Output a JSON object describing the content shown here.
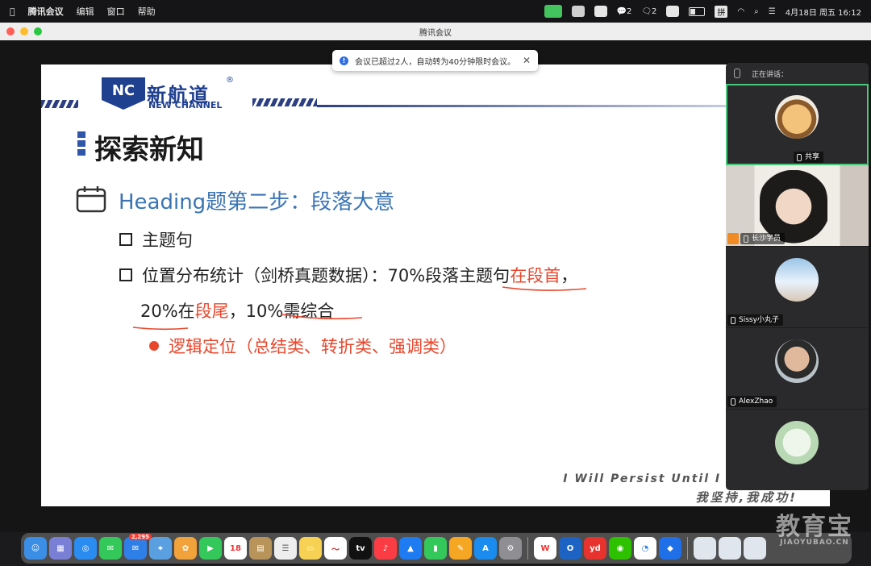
{
  "menubar": {
    "app_name": "腾讯会议",
    "menus": [
      "编辑",
      "窗口",
      "帮助"
    ],
    "chat_count_a": "2",
    "chat_count_b": "2",
    "ime": "拼",
    "datetime": "4月18日 周五  16:12"
  },
  "window": {
    "title": "腾讯会议"
  },
  "toast": {
    "message": "会议已超过2人，自动转为40分钟限时会议。"
  },
  "slide": {
    "logo_letters": "NC",
    "logo_cn": "新航道",
    "logo_en": "NEW CHANNEL",
    "logo_reg": "®",
    "title": "探索新知",
    "heading": "Heading题第二步：段落大意",
    "bullet1": "主题句",
    "bullet2_a": "位置分布统计（剑桥真题数据）：70%段落主题句",
    "bullet2_b": "在段首",
    "bullet2_c": "，",
    "bullet3_a": "20%在",
    "bullet3_b": "段尾",
    "bullet3_c": "，10%需综合",
    "bullet4": "逻辑定位（总结类、转折类、强调类）",
    "motto_en": "I Will Persist Until I Succeed!",
    "motto_cn": "我坚持,我成功!"
  },
  "participants": {
    "speaking_label": "正在讲话：",
    "tile1_suffix": "共享",
    "tile2_name": "长沙学员",
    "tile3_name": "Sissy小丸子",
    "tile4_name": "AlexZhao"
  },
  "dock": {
    "mail_badge": "2,295",
    "calendar_day": "18"
  },
  "watermark": {
    "cn": "教育宝",
    "en": "JIAOYUBAO.CN"
  }
}
